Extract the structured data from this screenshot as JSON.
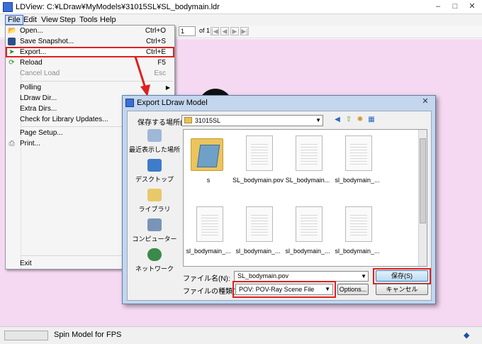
{
  "app": {
    "title": "LDView: C:¥LDraw¥MyModels¥31015SL¥SL_bodymain.ldr",
    "window_buttons": [
      "–",
      "□",
      "✕"
    ]
  },
  "menubar": {
    "items": [
      "File",
      "Edit",
      "View",
      "Step",
      "Tools",
      "Help"
    ],
    "active": "File"
  },
  "toolbar": {
    "step_label": ":",
    "step_value": "1",
    "of_label": "of 1"
  },
  "file_menu": {
    "items": [
      {
        "label": "Open...",
        "shortcut": "Ctrl+O",
        "icon": "folder-open-icon"
      },
      {
        "label": "Save Snapshot...",
        "shortcut": "Ctrl+S",
        "icon": "camera-icon"
      },
      {
        "label": "Export...",
        "shortcut": "Ctrl+E",
        "icon": "export-icon"
      },
      {
        "label": "Reload",
        "shortcut": "F5",
        "icon": "reload-icon"
      },
      {
        "label": "Cancel Load",
        "shortcut": "Esc"
      },
      {
        "label": "Polling"
      },
      {
        "label": "LDraw Dir..."
      },
      {
        "label": "Extra Dirs..."
      },
      {
        "label": "Check for Library Updates..."
      },
      {
        "label": "Page Setup..."
      },
      {
        "label": "Print...",
        "icon": "printer-icon"
      },
      {
        "label": "Exit"
      }
    ],
    "highlighted": "Export..."
  },
  "dialog": {
    "title": "Export LDraw Model",
    "save_in_label": "保存する場所(I):",
    "folder": "31015SL",
    "places": [
      "最近表示した場所",
      "デスクトップ",
      "ライブラリ",
      "コンピューター",
      "ネットワーク"
    ],
    "files": [
      "s",
      "SL_bodymain.pov",
      "SL_bodymain...",
      "sl_bodymain_...",
      "sl_bodymain_...",
      "sl_bodymain_...",
      "sl_bodymain_...",
      "sl_bodymain_..."
    ],
    "filename_label": "ファイル名(N):",
    "filename_value": "SL_bodymain.pov",
    "filetype_label": "ファイルの種類(T):",
    "filetype_value": "POV: POV-Ray Scene File",
    "options_button": "Options...",
    "save_button": "保存(S)",
    "cancel_button": "キャンセル"
  },
  "statusbar": {
    "text": "Spin Model for FPS"
  },
  "colors": {
    "viewport_bg": "#f5d8f2",
    "highlight_red": "#e02020",
    "dialog_frame": "#c3d6ee"
  }
}
